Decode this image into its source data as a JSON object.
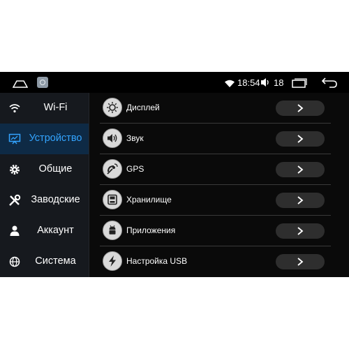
{
  "status": {
    "time": "18:54",
    "volume": "18"
  },
  "sidebar": {
    "items": [
      {
        "label": "Wi-Fi",
        "icon": "wifi-icon",
        "active": false
      },
      {
        "label": "Устройство",
        "icon": "device-icon",
        "active": true
      },
      {
        "label": "Общие",
        "icon": "gear-icon",
        "active": false
      },
      {
        "label": "Заводские",
        "icon": "tools-icon",
        "active": false
      },
      {
        "label": "Аккаунт",
        "icon": "account-icon",
        "active": false
      },
      {
        "label": "Система",
        "icon": "globe-icon",
        "active": false
      }
    ]
  },
  "settings": {
    "rows": [
      {
        "label": "Дисплей",
        "icon": "display-icon"
      },
      {
        "label": "Звук",
        "icon": "sound-icon"
      },
      {
        "label": "GPS",
        "icon": "gps-icon"
      },
      {
        "label": "Хранилище",
        "icon": "storage-icon"
      },
      {
        "label": "Приложения",
        "icon": "apps-icon"
      },
      {
        "label": "Настройка USB",
        "icon": "usb-icon"
      }
    ]
  },
  "colors": {
    "accent": "#33a4ff",
    "active_bg": "#0e2a45",
    "sidebar_bg": "#16191e",
    "screen_bg": "#0a0a0a"
  }
}
